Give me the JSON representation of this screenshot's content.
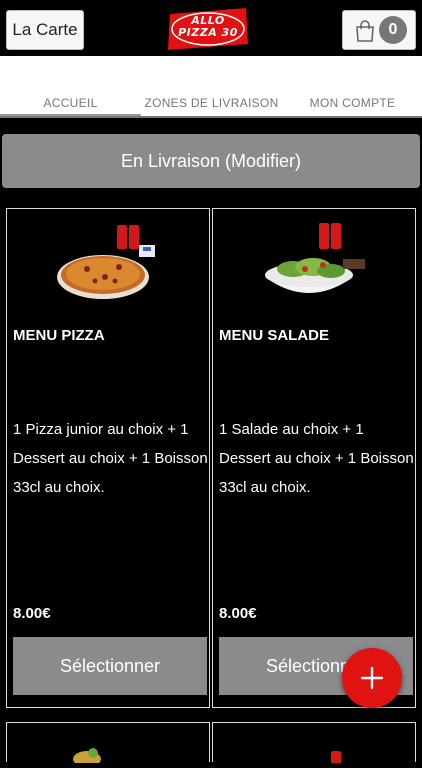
{
  "header": {
    "carte_label": "La Carte",
    "logo_line1": "ALLO",
    "logo_line2": "PIZZA 30",
    "cart_count": "0"
  },
  "tabs": [
    {
      "label": "ACCUEIL",
      "active": true
    },
    {
      "label": "ZONES DE LIVRAISON",
      "active": false
    },
    {
      "label": "MON COMPTE",
      "active": false
    }
  ],
  "delivery_button": "En Livraison (Modifier)",
  "menus": [
    {
      "title": "MENU PIZZA",
      "description": "1 Pizza junior au choix  + 1 Dessert au choix  + 1 Boisson 33cl au choix.",
      "price": "8.00€",
      "button": "Sélectionner",
      "image": "pizza-with-cola-cans"
    },
    {
      "title": "MENU SALADE",
      "description": "1 Salade au choix  + 1 Dessert au choix  + 1 Boisson 33cl au choix.",
      "price": "8.00€",
      "button": "Sélectionner",
      "image": "salad-with-cola-cans"
    }
  ],
  "colors": {
    "background": "#000000",
    "button_gray": "#8b8b8d",
    "fab_red": "#e01212",
    "logo_red": "#e01212"
  },
  "icons": {
    "cart": "shopping-bag-icon",
    "fab": "plus-icon"
  }
}
